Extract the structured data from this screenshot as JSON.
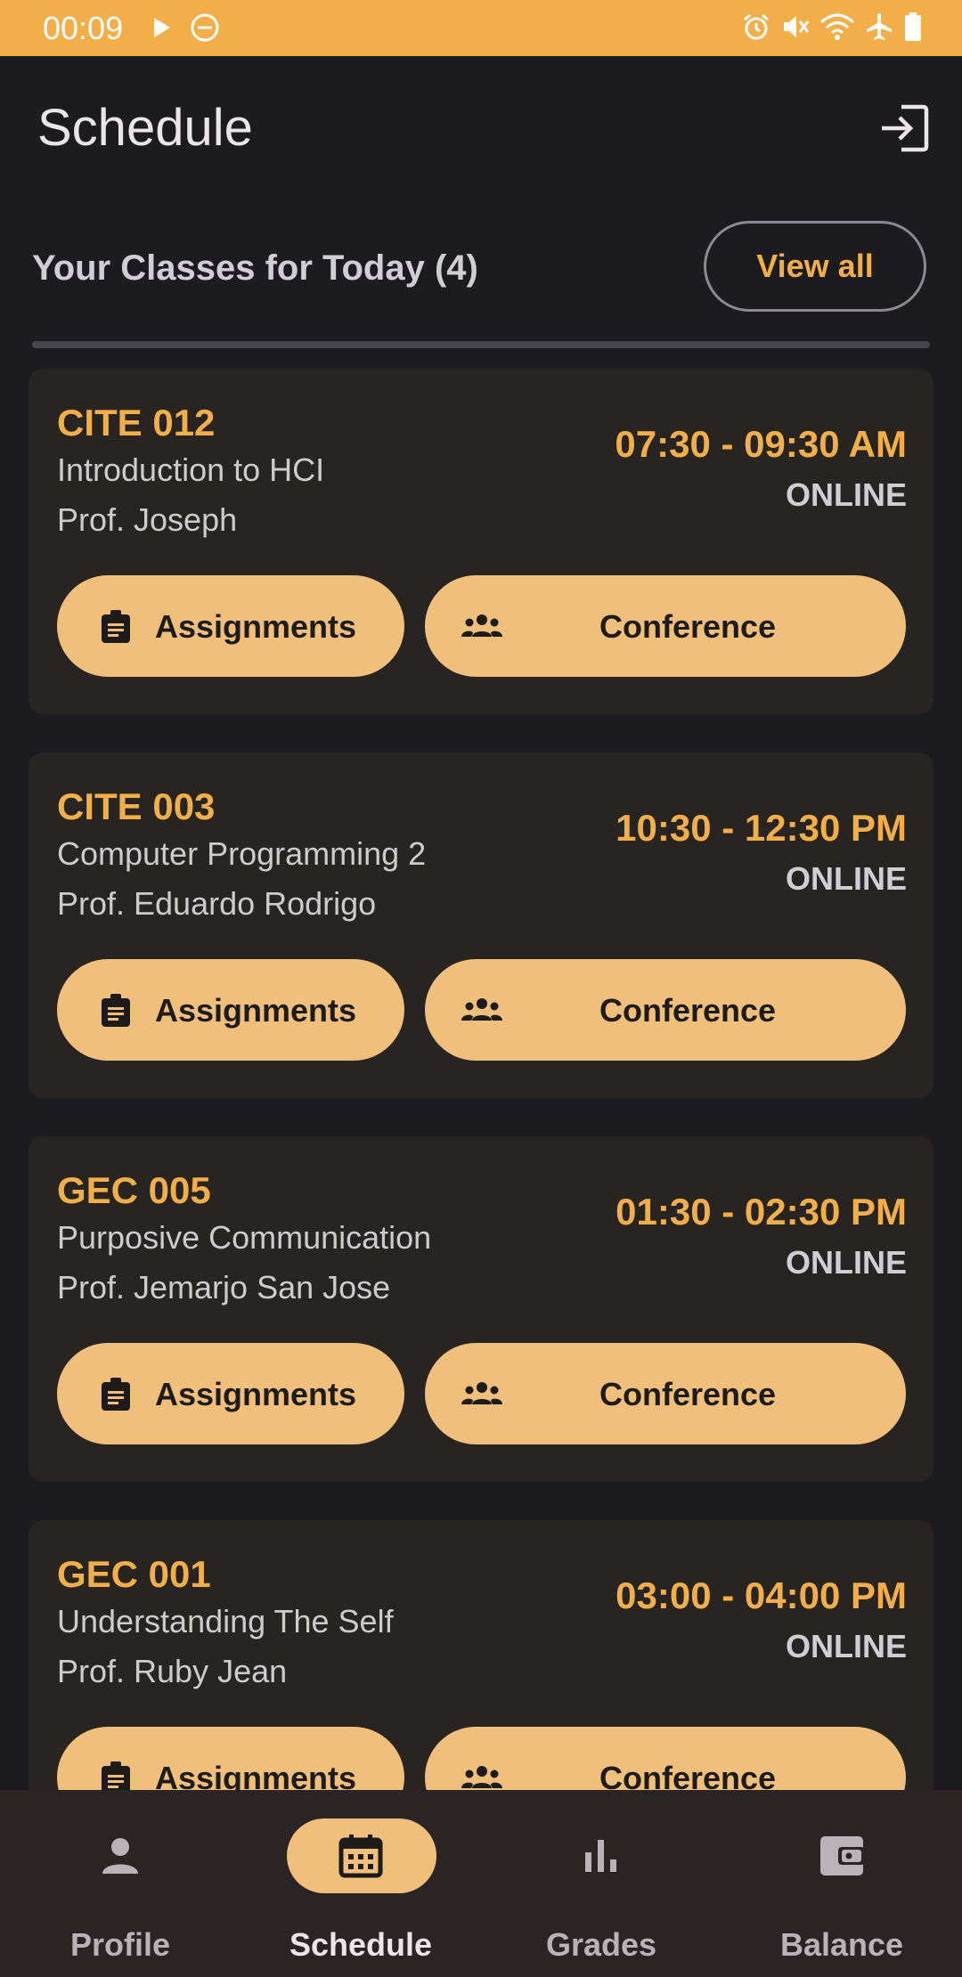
{
  "status_bar": {
    "time": "00:09",
    "color": "#f2ae49",
    "icons": [
      "play-icon",
      "do-not-disturb-icon",
      "alarm-icon",
      "mute-icon",
      "wifi-icon",
      "airplane-icon",
      "battery-icon"
    ]
  },
  "app_bar": {
    "title": "Schedule",
    "action_icon": "logout-icon"
  },
  "section": {
    "title": "Your Classes for Today (4)",
    "view_all_label": "View all"
  },
  "classes": [
    {
      "code": "CITE 012",
      "name": "Introduction to HCI",
      "professor": "Prof. Joseph",
      "time": "07:30 - 09:30 AM",
      "mode": "ONLINE",
      "assignments_label": "Assignments",
      "conference_label": "Conference"
    },
    {
      "code": "CITE 003",
      "name": "Computer Programming 2",
      "professor": "Prof. Eduardo Rodrigo",
      "time": "10:30 - 12:30 PM",
      "mode": "ONLINE",
      "assignments_label": "Assignments",
      "conference_label": "Conference"
    },
    {
      "code": "GEC 005",
      "name": "Purposive Communication",
      "professor": "Prof. Jemarjo San Jose",
      "time": "01:30 - 02:30 PM",
      "mode": "ONLINE",
      "assignments_label": "Assignments",
      "conference_label": "Conference"
    },
    {
      "code": "GEC 001",
      "name": "Understanding The Self",
      "professor": "Prof. Ruby Jean",
      "time": "03:00 - 04:00 PM",
      "mode": "ONLINE",
      "assignments_label": "Assignments",
      "conference_label": "Conference"
    }
  ],
  "bottom_nav": {
    "active": "Schedule",
    "items": [
      {
        "label": "Profile",
        "icon": "person-icon"
      },
      {
        "label": "Schedule",
        "icon": "calendar-icon"
      },
      {
        "label": "Grades",
        "icon": "bar-chart-icon"
      },
      {
        "label": "Balance",
        "icon": "wallet-icon"
      }
    ]
  },
  "colors": {
    "accent": "#f2ae49",
    "button": "#f0bf7b",
    "background": "#1c1b1f",
    "card": "#272422"
  }
}
